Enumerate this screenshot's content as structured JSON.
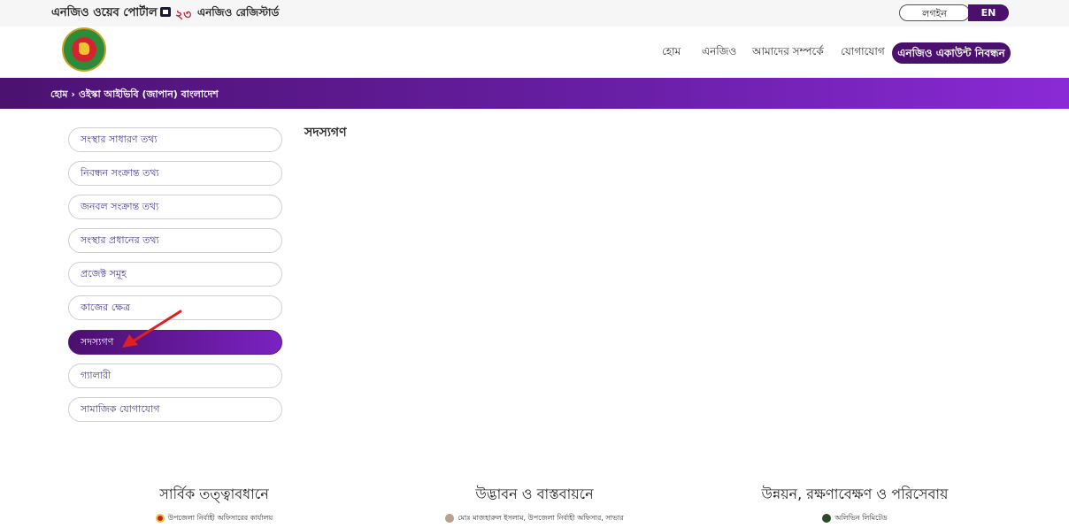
{
  "topbar": {
    "portal_title": "এনজিও ওয়েব পোর্টাল",
    "registered_count": "২৩",
    "registered_label": "এনজিও রেজিস্টার্ড",
    "login_label": "লগইন",
    "lang_label": "EN"
  },
  "header": {
    "nav": [
      "হোম",
      "এনজিও",
      "আমাদের সম্পর্কে",
      "যোগাযোগ"
    ],
    "cta_label": "এনজিও একাউন্ট নিবন্ধন"
  },
  "breadcrumb": "হোম › ওইস্কা আইভিবি (জাপান) বাংলাদেশ",
  "sidebar": {
    "items": [
      {
        "label": "সংস্থার সাধারণ তথ্য",
        "active": false
      },
      {
        "label": "নিবন্ধন সংক্রান্ত তথ্য",
        "active": false
      },
      {
        "label": "জনবল সংক্রান্ত তথ্য",
        "active": false
      },
      {
        "label": "সংস্থার প্রধানের তথ্য",
        "active": false
      },
      {
        "label": "প্রজেক্ট সমূহ",
        "active": false
      },
      {
        "label": "কাজের ক্ষেত্র",
        "active": false
      },
      {
        "label": "সদস্যগণ",
        "active": true
      },
      {
        "label": "গ্যালারী",
        "active": false
      },
      {
        "label": "সামাজিক যোগাযোগ",
        "active": false
      }
    ]
  },
  "main": {
    "title": "সদস্যগণ"
  },
  "footer": {
    "columns": [
      {
        "heading": "সার্বিক তত্ত্বাবধানে",
        "sub": "উপজেলা নির্বাহী অফিসারের কার্যালয়"
      },
      {
        "heading": "উদ্ভাবন ও বাস্তবায়নে",
        "sub": "মোঃ মাজহারুল ইসলাম, উপজেলা নির্বাহী অফিসার, সাভার"
      },
      {
        "heading": "উন্নয়ন, রক্ষণাবেক্ষণ ও পরিসেবায়",
        "sub": "অলিভিন লিমিটেড"
      }
    ]
  },
  "colors": {
    "brand_purple": "#4b0f6e",
    "accent_purple": "#7a22c2",
    "count_red": "#c41f3a",
    "annotation_arrow": "#e02020"
  }
}
